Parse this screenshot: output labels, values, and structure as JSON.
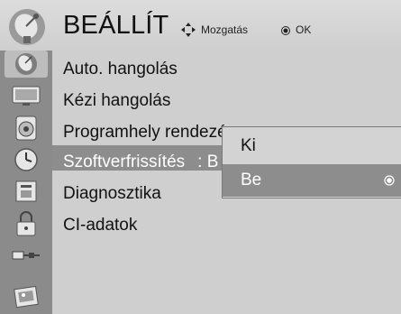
{
  "header": {
    "title": "BEÁLLÍT",
    "nav_hint": "Mozgatás",
    "ok_hint": "OK"
  },
  "sidebar": {
    "items": [
      {
        "icon": "satellite-dish-icon"
      },
      {
        "icon": "tv-screen-icon"
      },
      {
        "icon": "speaker-icon"
      },
      {
        "icon": "clock-icon"
      },
      {
        "icon": "lock-screen-icon"
      },
      {
        "icon": "padlock-icon"
      },
      {
        "icon": "input-cable-icon"
      },
      {
        "icon": "photo-icon"
      }
    ],
    "active_index": 0
  },
  "menu": {
    "items": [
      {
        "label": "Auto. hangolás"
      },
      {
        "label": "Kézi hangolás"
      },
      {
        "label": "Programhely rendezése"
      },
      {
        "label": "Szoftverfrissítés",
        "value": ": B"
      },
      {
        "label": "Diagnosztika"
      },
      {
        "label": "CI-adatok"
      }
    ],
    "selected_index": 3
  },
  "popup": {
    "options": [
      {
        "label": "Ki"
      },
      {
        "label": "Be"
      }
    ],
    "selected_index": 1
  },
  "colors": {
    "background": "#c9c9c9",
    "sidebar": "#8b8b8b",
    "highlight": "#8d8d8d",
    "text": "#111111",
    "highlight_text": "#ffffff"
  }
}
